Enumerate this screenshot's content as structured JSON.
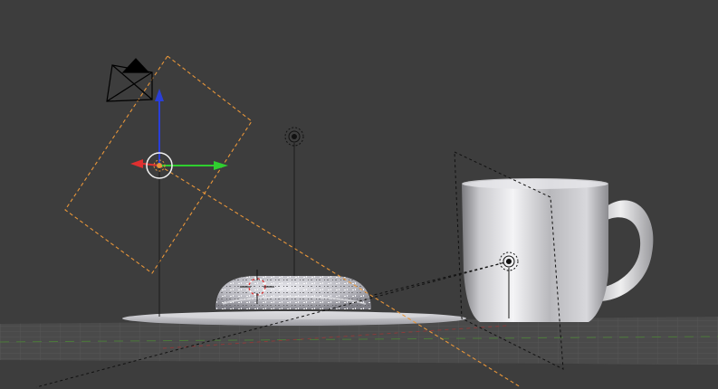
{
  "viewport": {
    "background": "#3d3d3d",
    "grid_color": "#555555",
    "x_axis_color": "#8a3b3b",
    "y_axis_color": "#4c7a3a"
  },
  "selection_color": "#e8963a",
  "gizmo": {
    "x_color": "#e03030",
    "y_color": "#2fcf2f",
    "z_color": "#2a3fd8"
  },
  "objects": [
    {
      "name": "camera",
      "icon": "camera-icon"
    },
    {
      "name": "point-lamp",
      "icon": "lamp-icon"
    },
    {
      "name": "spot-lamp",
      "icon": "lamp-icon"
    },
    {
      "name": "donut",
      "icon": "mesh"
    },
    {
      "name": "plate",
      "icon": "mesh"
    },
    {
      "name": "mug",
      "icon": "mesh"
    },
    {
      "name": "3d-cursor",
      "icon": "cursor-icon"
    }
  ]
}
